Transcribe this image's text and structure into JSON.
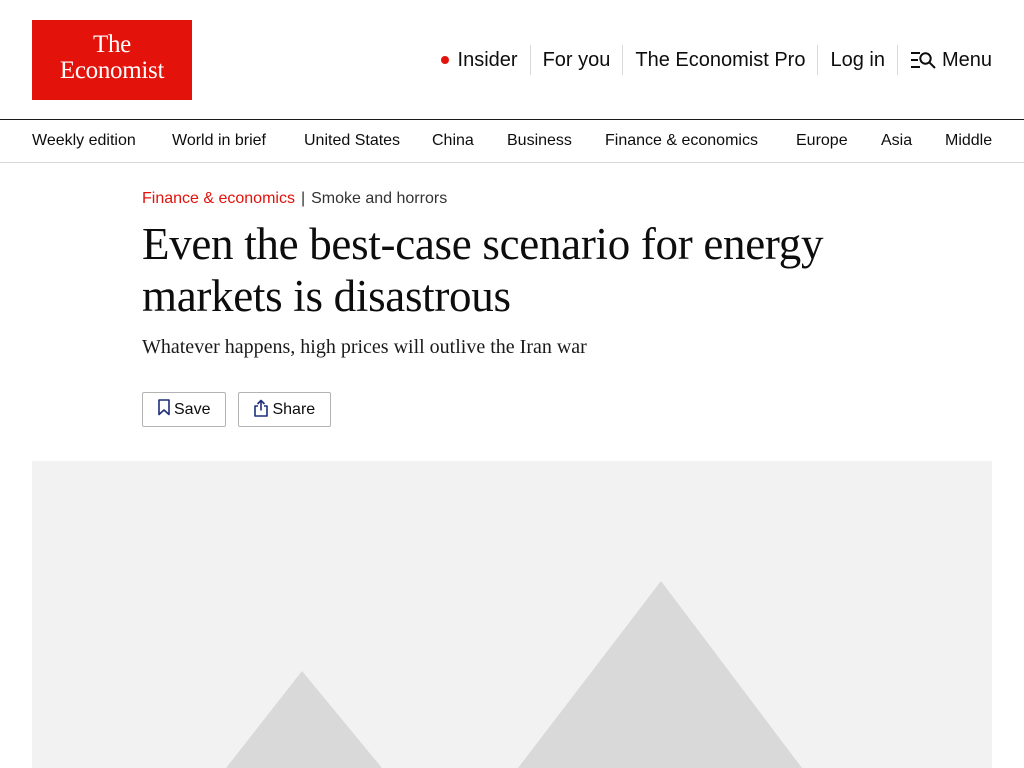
{
  "header": {
    "logo": {
      "line1": "The",
      "line2": "Economist"
    },
    "nav": [
      {
        "label": "Insider",
        "icon": "live-dot-icon"
      },
      {
        "label": "For you"
      },
      {
        "label": "The Economist Pro"
      },
      {
        "label": "Log in"
      },
      {
        "label": "Menu",
        "icon": "menu-search-icon"
      }
    ]
  },
  "sections": [
    "Weekly edition",
    "World in brief",
    "United States",
    "China",
    "Business",
    "Finance & economics",
    "Europe",
    "Asia",
    "Middle"
  ],
  "article": {
    "section": "Finance & economics",
    "rubric": "Smoke and horrors",
    "headline": "Even the best-case scenario for energy markets is disastrous",
    "standfirst": "Whatever happens, high prices will outlive the Iran war",
    "actions": {
      "save": "Save",
      "share": "Share"
    }
  },
  "hero": {
    "icon": "image-placeholder-icon"
  },
  "colors": {
    "brand_red": "#e3120b",
    "placeholder_bg": "#f2f2f2",
    "placeholder_shape": "#d9d9d9"
  }
}
